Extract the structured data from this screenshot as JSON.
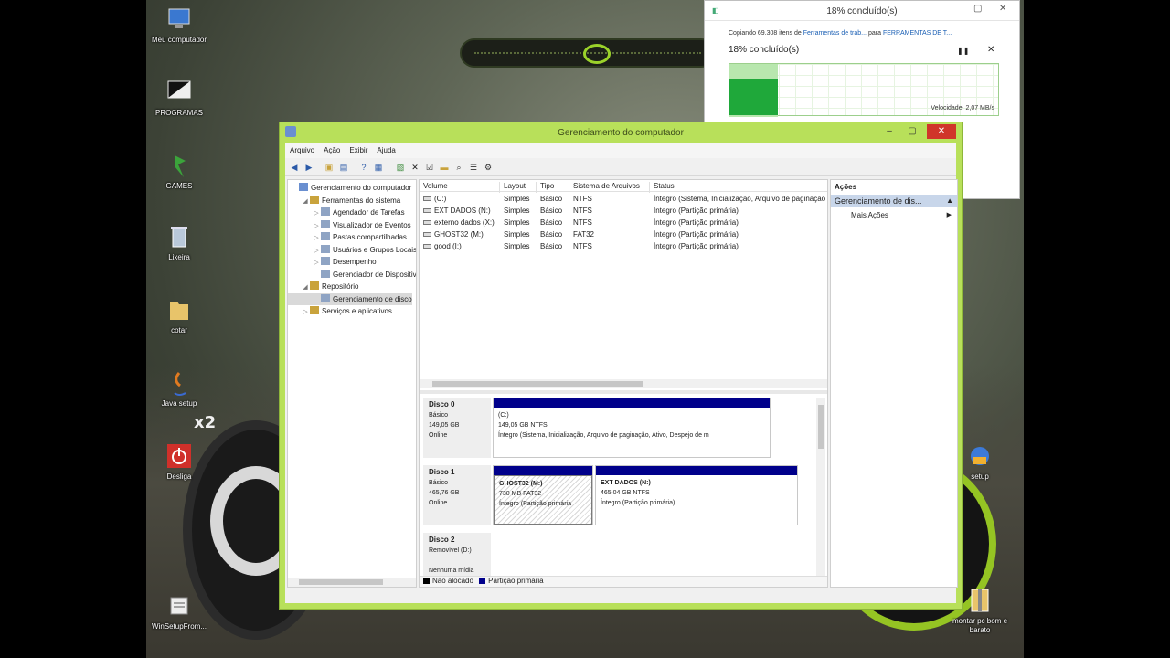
{
  "desktop": {
    "icons": [
      {
        "label": "Meu computador"
      },
      {
        "label": "PROGRAMAS"
      },
      {
        "label": "GAMES"
      },
      {
        "label": "Lixeira"
      },
      {
        "label": "cotar"
      },
      {
        "label": "Java setup"
      },
      {
        "label": "Desliga"
      },
      {
        "label": "WinSetupFrom..."
      },
      {
        "label": "setup"
      },
      {
        "label": "montar pc bom e barato"
      }
    ],
    "game_overlay": "x2"
  },
  "copy_dialog": {
    "title": "18% concluído(s)",
    "copying_prefix": "Copiando 69.308 itens de",
    "source": "Ferramentas de trab...",
    "to": "para",
    "destination": "FERRAMENTAS DE T...",
    "percent_text": "18% concluído(s)",
    "progress": 0.18,
    "speed": "Velocidade: 2,07 MB/s",
    "pause_icon": "pause-icon",
    "close_icon": "close-icon"
  },
  "mmc": {
    "title": "Gerenciamento do computador",
    "menu": [
      "Arquivo",
      "Ação",
      "Exibir",
      "Ajuda"
    ],
    "tree": [
      {
        "label": "Gerenciamento do computador",
        "level": 0,
        "twisty": "",
        "selected": false
      },
      {
        "label": "Ferramentas do sistema",
        "level": 1,
        "twisty": "◢",
        "selected": false
      },
      {
        "label": "Agendador de Tarefas",
        "level": 2,
        "twisty": "▷",
        "selected": false
      },
      {
        "label": "Visualizador de Eventos",
        "level": 2,
        "twisty": "▷",
        "selected": false
      },
      {
        "label": "Pastas compartilhadas",
        "level": 2,
        "twisty": "▷",
        "selected": false
      },
      {
        "label": "Usuários e Grupos Locais",
        "level": 2,
        "twisty": "▷",
        "selected": false
      },
      {
        "label": "Desempenho",
        "level": 2,
        "twisty": "▷",
        "selected": false
      },
      {
        "label": "Gerenciador de Dispositivos",
        "level": 2,
        "twisty": "",
        "selected": false
      },
      {
        "label": "Repositório",
        "level": 1,
        "twisty": "◢",
        "selected": false
      },
      {
        "label": "Gerenciamento de disco",
        "level": 2,
        "twisty": "",
        "selected": true
      },
      {
        "label": "Serviços e aplicativos",
        "level": 1,
        "twisty": "▷",
        "selected": false
      }
    ],
    "columns": [
      "Volume",
      "Layout",
      "Tipo",
      "Sistema de Arquivos",
      "Status"
    ],
    "volumes": [
      {
        "volume": "(C:)",
        "layout": "Simples",
        "tipo": "Básico",
        "fs": "NTFS",
        "status": "Íntegro (Sistema, Inicialização, Arquivo de paginação"
      },
      {
        "volume": "EXT DADOS (N:)",
        "layout": "Simples",
        "tipo": "Básico",
        "fs": "NTFS",
        "status": "Íntegro (Partição primária)"
      },
      {
        "volume": "externo dados (X:)",
        "layout": "Simples",
        "tipo": "Básico",
        "fs": "NTFS",
        "status": "Íntegro (Partição primária)"
      },
      {
        "volume": "GHOST32 (M:)",
        "layout": "Simples",
        "tipo": "Básico",
        "fs": "FAT32",
        "status": "Íntegro (Partição primária)"
      },
      {
        "volume": "good (I:)",
        "layout": "Simples",
        "tipo": "Básico",
        "fs": "NTFS",
        "status": "Íntegro (Partição primária)"
      }
    ],
    "disks": [
      {
        "name": "Disco 0",
        "type": "Básico",
        "size": "149,05 GB",
        "state": "Online"
      },
      {
        "name": "Disco 1",
        "type": "Básico",
        "size": "465,76 GB",
        "state": "Online"
      },
      {
        "name": "Disco 2",
        "type": "Removível (D:)",
        "size": "",
        "state": "Nenhuma mídia"
      }
    ],
    "partitions": {
      "c": {
        "name": "(C:)",
        "size": "149,05 GB NTFS",
        "status": "Íntegro (Sistema, Inicialização, Arquivo de paginação, Ativo, Despejo de m"
      },
      "ghost": {
        "name": "GHOST32  (M:)",
        "size": "730 MB FAT32",
        "status": "Íntegro (Partição primária"
      },
      "ext": {
        "name": "EXT DADOS  (N:)",
        "size": "465,04 GB NTFS",
        "status": "Íntegro (Partição primária)"
      }
    },
    "legend": {
      "unallocated": "Não alocado",
      "primary": "Partição primária",
      "unallocated_color": "#000000",
      "primary_color": "#00008b"
    },
    "actions": {
      "header": "Ações",
      "section": "Gerenciamento de dis...",
      "more": "Mais Ações"
    }
  }
}
